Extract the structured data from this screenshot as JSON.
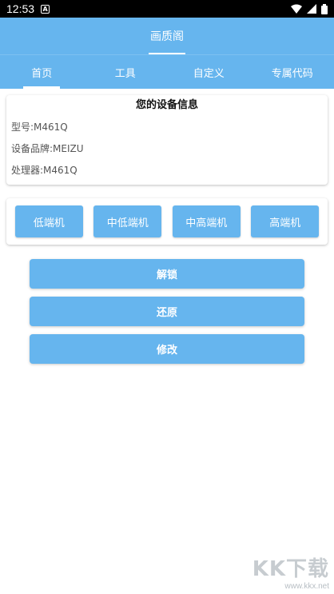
{
  "status_bar": {
    "time": "12:53",
    "notification_glyph": "A"
  },
  "app_bar": {
    "title": "画质阁"
  },
  "tabs": [
    {
      "label": "首页",
      "active": true
    },
    {
      "label": "工具",
      "active": false
    },
    {
      "label": "自定义",
      "active": false
    },
    {
      "label": "专属代码",
      "active": false
    }
  ],
  "device_info": {
    "title": "您的设备信息",
    "model": "型号:M461Q",
    "brand": "设备品牌:MEIZU",
    "processor": "处理器:M461Q"
  },
  "tiers": [
    "低端机",
    "中低端机",
    "中高端机",
    "高端机"
  ],
  "actions": {
    "unlock": "解锁",
    "restore": "还原",
    "modify": "修改"
  },
  "watermark": {
    "logo": "KK下载",
    "url": "www.kkx.net"
  },
  "colors": {
    "primary": "#66b5ee",
    "statusbar": "#000000"
  },
  "icons": [
    "notification-a-icon",
    "wifi-icon",
    "signal-icon",
    "battery-icon"
  ]
}
